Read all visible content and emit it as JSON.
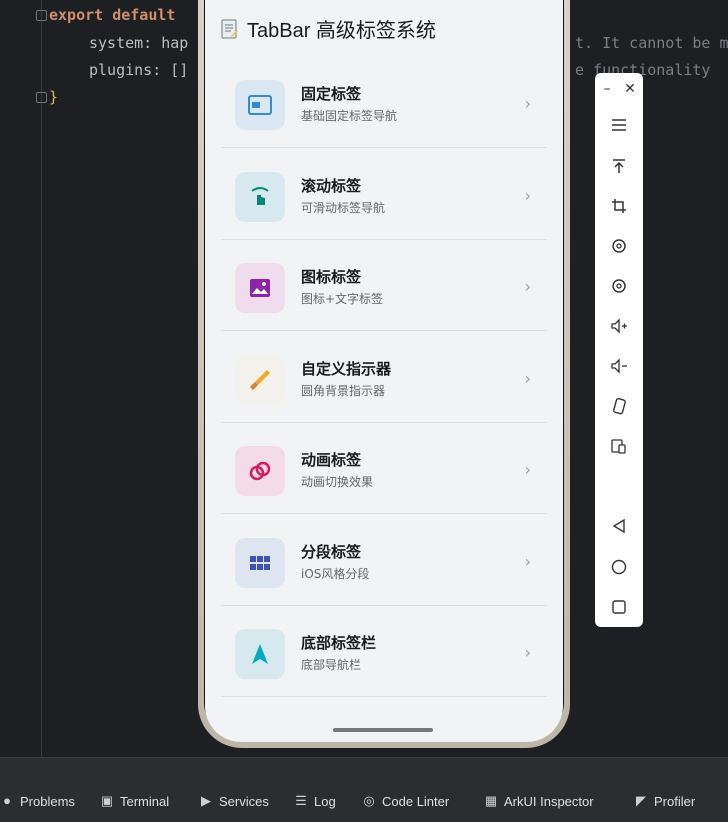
{
  "editor": {
    "line1_keyword": "export default",
    "line2": "system: hap",
    "line2_overflow": "t. It cannot be mo",
    "line3": "plugins: []",
    "line3_overflow": "e functionality",
    "line4": "}"
  },
  "app": {
    "title": "TabBar 高级标签系统",
    "items": [
      {
        "name": "固定标签",
        "desc": "基础固定标签导航",
        "icon": "window-icon",
        "bg": "#dbe8f3",
        "color": "#2f8ae0"
      },
      {
        "name": "滚动标签",
        "desc": "可滑动标签导航",
        "icon": "swipe-hand-icon",
        "bg": "#d7e9ef",
        "color": "#00897b"
      },
      {
        "name": "图标标签",
        "desc": "图标+文字标签",
        "icon": "image-icon",
        "bg": "#efdcec",
        "color": "#8e24aa"
      },
      {
        "name": "自定义指示器",
        "desc": "圆角背景指示器",
        "icon": "paintbrush-icon",
        "bg": "#f3f1ec",
        "color": "#f5a623"
      },
      {
        "name": "动画标签",
        "desc": "动画切换效果",
        "icon": "rings-icon",
        "bg": "#f3dce8",
        "color": "#d81b60"
      },
      {
        "name": "分段标签",
        "desc": "iOS风格分段",
        "icon": "grid-icon",
        "bg": "#dde6f0",
        "color": "#3f51b5"
      },
      {
        "name": "底部标签栏",
        "desc": "底部导航栏",
        "icon": "navigation-arrow-icon",
        "bg": "#d8e8ef",
        "color": "#00acc1"
      }
    ]
  },
  "panel": {
    "buttons": [
      "minimize-icon",
      "close-icon",
      "menu-icon",
      "pin-top-icon",
      "crop-icon",
      "rotate-left-icon",
      "rotate-right-icon",
      "volume-up-icon",
      "volume-down-icon",
      "shake-icon",
      "screenshot-icon",
      "back-icon",
      "home-icon",
      "recent-apps-icon"
    ]
  },
  "toolbar": {
    "tabs": [
      {
        "label": "Problems",
        "icon": "problems-icon"
      },
      {
        "label": "Terminal",
        "icon": "terminal-icon"
      },
      {
        "label": "Services",
        "icon": "services-icon"
      },
      {
        "label": "Log",
        "icon": "log-icon"
      },
      {
        "label": "Code Linter",
        "icon": "code-linter-icon"
      },
      {
        "label": "ArkUI Inspector",
        "icon": "inspector-icon"
      },
      {
        "label": "Profiler",
        "icon": "profiler-icon"
      }
    ]
  }
}
